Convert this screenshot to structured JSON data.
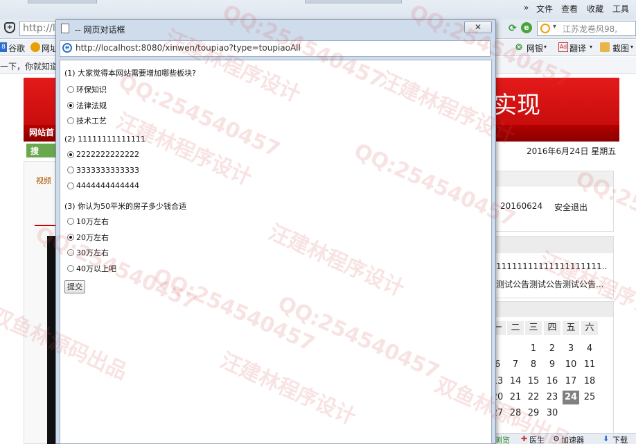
{
  "browser": {
    "menu": [
      "文件",
      "查看",
      "收藏",
      "工具"
    ],
    "menu_arrow": "»",
    "address_partial": "http://l",
    "search_text": "江苏龙卷风98,",
    "fav_items": [
      "谷歌",
      "网址"
    ],
    "right_toolbar": [
      "网银",
      "翻译",
      "截图"
    ],
    "message": "一下，你就知道"
  },
  "page_behind": {
    "banner_title": "实现",
    "nav_home": "网站首",
    "search_label": "搜索：",
    "date": "2016年6月24日  星期五",
    "left_panel_title": "视频",
    "user_id": "20160624",
    "logout": "安全退出",
    "notices": [
      "11111111111111111111...",
      "测试公告测试公告测试公告..."
    ],
    "calendar": {
      "headers": [
        "一",
        "二",
        "三",
        "四",
        "五",
        "六"
      ],
      "rows": [
        [
          "",
          "",
          "1",
          "2",
          "3",
          "4"
        ],
        [
          "6",
          "7",
          "8",
          "9",
          "10",
          "11"
        ],
        [
          "13",
          "14",
          "15",
          "16",
          "17",
          "18"
        ],
        [
          "20",
          "21",
          "22",
          "23",
          "24",
          "25"
        ],
        [
          "27",
          "28",
          "29",
          "30",
          "",
          ""
        ]
      ],
      "today": "24"
    },
    "status_bar": [
      "浏览",
      "医生",
      "加速器",
      "下载"
    ]
  },
  "dialog": {
    "title": "-- 网页对话框",
    "close": "✕",
    "url": "http://localhost:8080/xinwen/toupiao?type=toupiaoAll",
    "questions": [
      {
        "q": "(1) 大家觉得本网站需要增加哪些板块?",
        "options": [
          "环保知识",
          "法律法规",
          "技术工艺"
        ],
        "selected": 1
      },
      {
        "q": "(2) 11111111111111",
        "options": [
          "2222222222222",
          "3333333333333",
          "4444444444444"
        ],
        "selected": 0
      },
      {
        "q": "(3) 你认为50平米的房子多少钱合适",
        "options": [
          "10万左右",
          "20万左右",
          "30万左右",
          "40万以上吧"
        ],
        "selected": 1
      }
    ],
    "submit_label": "提交"
  },
  "watermarks": [
    "QQ:254540457",
    "汪建林程序设计",
    "双鱼林源码出品"
  ]
}
